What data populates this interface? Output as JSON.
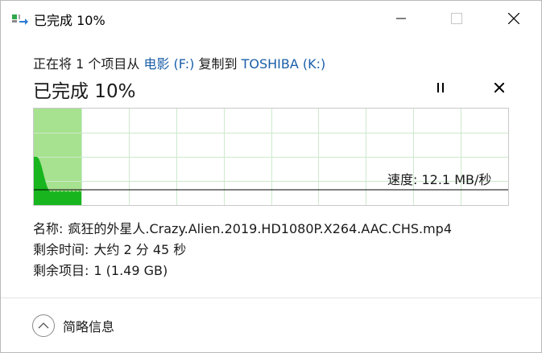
{
  "window": {
    "title": "已完成 10%"
  },
  "copy": {
    "prefix": "正在将 1 个项目从 ",
    "source": "电影 (F:)",
    "middle": " 复制到 ",
    "destination": "TOSHIBA (K:)"
  },
  "status": {
    "headline": "已完成 10%",
    "progress_percent": 10,
    "speed": "速度: 12.1 MB/秒"
  },
  "details": {
    "name_label": "名称:",
    "name_value": "疯狂的外星人.Crazy.Alien.2019.HD1080P.X264.AAC.CHS.mp4",
    "time_label": "剩余时间:",
    "time_value": "大约 2 分 45 秒",
    "items_label": "剩余项目:",
    "items_value": "1 (1.49 GB)"
  },
  "footer": {
    "toggle_label": "简略信息"
  },
  "icons": {
    "app": "copy-files-icon",
    "minimize": "minimize-icon",
    "maximize": "maximize-icon",
    "close": "close-icon",
    "pause": "pause-icon",
    "cancel": "cancel-icon",
    "toggle": "chevron-up-icon"
  },
  "colors": {
    "progress_fill": "#a6e28f",
    "speed_area": "#18b51e",
    "grid": "#cde9cd",
    "link": "#1a5ea8"
  }
}
